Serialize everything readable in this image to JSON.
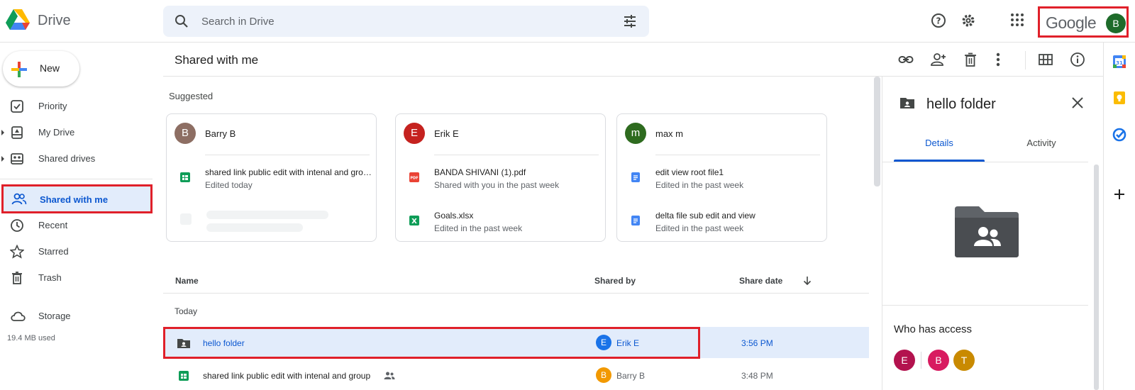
{
  "app": {
    "name": "Drive",
    "google_wordmark": "Google",
    "account_initial": "B"
  },
  "search": {
    "placeholder": "Search in Drive"
  },
  "header": {
    "icons": [
      "help-icon",
      "settings-icon",
      "apps-grid-icon"
    ]
  },
  "sidebar": {
    "new_label": "New",
    "items": [
      {
        "label": "Priority",
        "icon": "priority-check-icon"
      },
      {
        "label": "My Drive",
        "icon": "my-drive-icon"
      },
      {
        "label": "Shared drives",
        "icon": "shared-drives-icon"
      },
      {
        "label": "Shared with me",
        "icon": "people-icon",
        "selected": true
      },
      {
        "label": "Recent",
        "icon": "clock-icon"
      },
      {
        "label": "Starred",
        "icon": "star-icon"
      },
      {
        "label": "Trash",
        "icon": "trash-icon"
      },
      {
        "label": "Storage",
        "icon": "cloud-icon"
      }
    ],
    "storage_used": "19.4 MB used"
  },
  "main": {
    "title": "Shared with me",
    "toolbar": [
      "link-icon",
      "add-person-icon",
      "trash-icon",
      "more-vert-icon",
      "grid-view-icon",
      "info-icon"
    ],
    "suggested_label": "Suggested",
    "cards": [
      {
        "owner_initial": "B",
        "owner_name": "Barry B",
        "avatar_color": "#8d6e63",
        "files": [
          {
            "name": "shared link public edit with intenal and group",
            "sub": "Edited today",
            "type": "sheets"
          }
        ]
      },
      {
        "owner_initial": "E",
        "owner_name": "Erik E",
        "avatar_color": "#c5221f",
        "files": [
          {
            "name": "BANDA SHIVANI (1).pdf",
            "sub": "Shared with you in the past week",
            "type": "pdf"
          },
          {
            "name": "Goals.xlsx",
            "sub": "Edited in the past week",
            "type": "excel"
          }
        ]
      },
      {
        "owner_initial": "m",
        "owner_name": "max m",
        "avatar_color": "#2e6b1f",
        "files": [
          {
            "name": "edit view root file1",
            "sub": "Edited in the past week",
            "type": "docs"
          },
          {
            "name": "delta file sub edit and view",
            "sub": "Edited in the past week",
            "type": "docs"
          }
        ]
      }
    ],
    "table": {
      "headers": {
        "name": "Name",
        "shared_by": "Shared by",
        "share_date": "Share date"
      },
      "group_label": "Today",
      "rows": [
        {
          "name": "hello folder",
          "shared_by": "Erik E",
          "shared_by_initial": "E",
          "avatar_color": "#1a73e8",
          "date": "3:56 PM",
          "selected": true,
          "type": "shared-folder"
        },
        {
          "name": "shared link public edit with intenal and group",
          "shared_by": "Barry B",
          "shared_by_initial": "B",
          "avatar_color": "#f29900",
          "date": "3:48 PM",
          "selected": false,
          "type": "sheets"
        }
      ]
    }
  },
  "details_panel": {
    "title": "hello folder",
    "tabs": [
      "Details",
      "Activity"
    ],
    "active_tab": "Details",
    "who_has_access_label": "Who has access",
    "access_avatars": [
      {
        "initial": "E",
        "color": "#b3124e"
      },
      {
        "initial": "B",
        "color": "#d81b60"
      },
      {
        "initial": "T",
        "color": "#c98a00"
      }
    ]
  },
  "side_apps": [
    "calendar-icon",
    "keep-icon",
    "tasks-icon",
    "add-icon"
  ],
  "colors": {
    "accent": "#0b57d0",
    "selected_bg": "#e2ecfb",
    "highlight_box": "#e0202a"
  }
}
